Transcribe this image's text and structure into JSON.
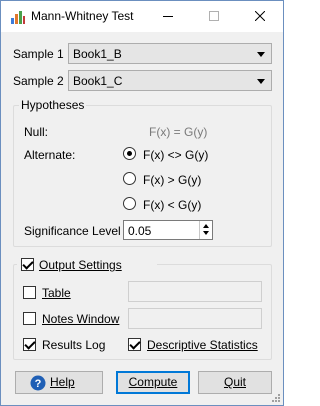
{
  "window": {
    "title": "Mann-Whitney Test"
  },
  "sample1": {
    "label": "Sample 1",
    "value": "Book1_B"
  },
  "sample2": {
    "label": "Sample 2",
    "value": "Book1_C"
  },
  "hypotheses": {
    "title": "Hypotheses",
    "null_label": "Null:",
    "null_value": "F(x) = G(y)",
    "alternate_label": "Alternate:",
    "options": [
      "F(x) <> G(y)",
      "F(x) > G(y)",
      "F(x) < G(y)"
    ],
    "selected_index": 0,
    "significance_label": "Significance Level",
    "significance_value": "0.05"
  },
  "output": {
    "title": "Output Settings",
    "checked": true,
    "table": {
      "label": "Table",
      "checked": false
    },
    "notes": {
      "label": "Notes Window",
      "checked": false
    },
    "results_log": {
      "label": "Results Log",
      "checked": true
    },
    "descriptive": {
      "label": "Descriptive Statistics",
      "checked": true
    }
  },
  "buttons": {
    "help": "Help",
    "compute": "Compute",
    "quit": "Quit"
  }
}
